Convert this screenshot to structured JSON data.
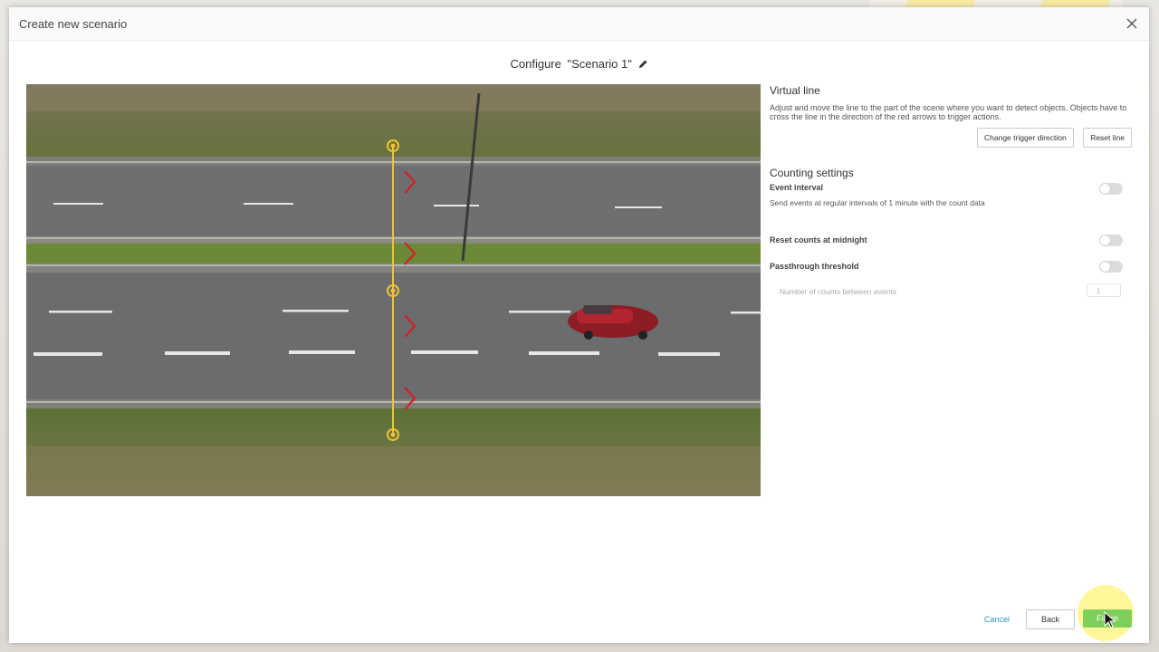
{
  "dialog": {
    "title": "Create new scenario",
    "configure_label": "Configure",
    "scenario_name": "\"Scenario 1\""
  },
  "virtual_line": {
    "title": "Virtual line",
    "description": "Adjust and move the line to the part of the scene where you want to detect objects. Objects have to cross the line in the direction of the red arrows to trigger actions.",
    "change_direction_label": "Change trigger direction",
    "reset_line_label": "Reset line"
  },
  "counting": {
    "title": "Counting settings",
    "event_interval_label": "Event interval",
    "event_interval_desc": "Send events at regular intervals of 1 minute with the count data",
    "event_interval_on": false,
    "reset_midnight_label": "Reset counts at midnight",
    "reset_midnight_on": false,
    "passthrough_label": "Passthrough threshold",
    "passthrough_on": false,
    "counts_between_label": "Number of counts between events",
    "counts_between_value": "1"
  },
  "footer": {
    "cancel_label": "Cancel",
    "back_label": "Back",
    "finish_label": "Finish"
  },
  "colors": {
    "accent_green": "#7fcf5b",
    "link_blue": "#2a93b8",
    "line_yellow": "#f2c230",
    "arrow_red": "#d41c2a",
    "car_red": "#9c1e26"
  },
  "icons": [
    "close-icon",
    "pencil-icon",
    "cursor-icon"
  ]
}
